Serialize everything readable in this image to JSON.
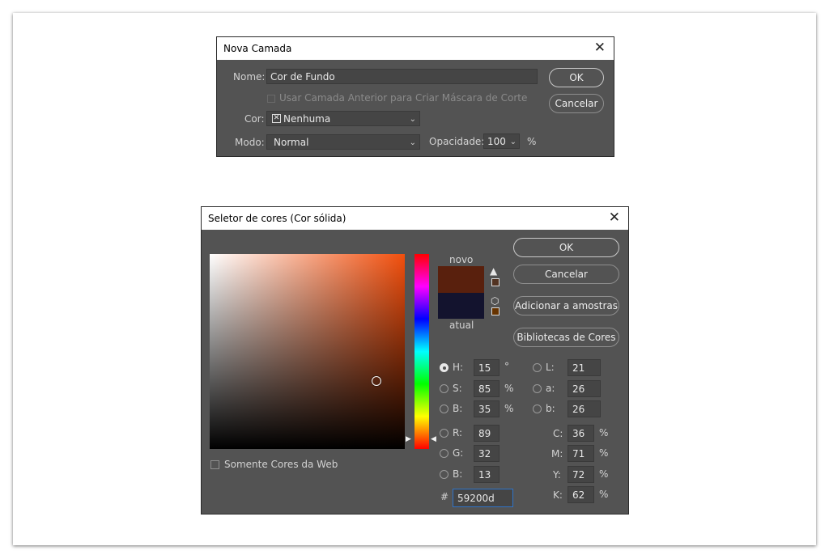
{
  "layer_dialog": {
    "title": "Nova Camada",
    "name_label": "Nome:",
    "name_value": "Cor de Fundo",
    "clip_mask_label": "Usar Camada Anterior para Criar Máscara de Corte",
    "color_label": "Cor:",
    "color_value": "Nenhuma",
    "mode_label": "Modo:",
    "mode_value": "Normal",
    "opacity_label": "Opacidade:",
    "opacity_value": "100",
    "opacity_unit": "%",
    "ok_label": "OK",
    "cancel_label": "Cancelar"
  },
  "picker_dialog": {
    "title": "Seletor de cores (Cor sólida)",
    "ok_label": "OK",
    "cancel_label": "Cancelar",
    "add_swatches_label": "Adicionar a amostras",
    "color_libraries_label": "Bibliotecas de Cores",
    "new_label": "novo",
    "current_label": "atual",
    "new_color": "#59200d",
    "current_color": "#13132e",
    "hue_color": "#f24f0d",
    "web_only_label": "Somente Cores da Web",
    "fields": {
      "H": {
        "label": "H:",
        "value": "15",
        "unit": "°"
      },
      "S": {
        "label": "S:",
        "value": "85",
        "unit": "%"
      },
      "Bv": {
        "label": "B:",
        "value": "35",
        "unit": "%"
      },
      "R": {
        "label": "R:",
        "value": "89"
      },
      "G": {
        "label": "G:",
        "value": "32"
      },
      "Bc": {
        "label": "B:",
        "value": "13"
      },
      "L": {
        "label": "L:",
        "value": "21"
      },
      "a": {
        "label": "a:",
        "value": "26"
      },
      "b": {
        "label": "b:",
        "value": "26"
      },
      "C": {
        "label": "C:",
        "value": "36",
        "unit": "%"
      },
      "M": {
        "label": "M:",
        "value": "71",
        "unit": "%"
      },
      "Y": {
        "label": "Y:",
        "value": "72",
        "unit": "%"
      },
      "K": {
        "label": "K:",
        "value": "62",
        "unit": "%"
      }
    },
    "hex_label": "#",
    "hex_value": "59200d"
  }
}
